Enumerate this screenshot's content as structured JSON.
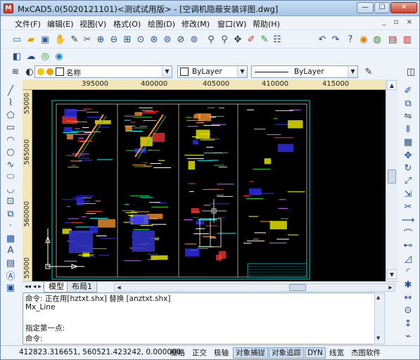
{
  "window": {
    "title": "MxCAD5.0(5020121101)<测试试用版> - [空调机隐蔽安装详图.dwg]",
    "app_icon": "mxcad-app-icon",
    "controls": {
      "minimize": "—",
      "maximize": "☐",
      "close": "✕"
    }
  },
  "menu": {
    "items": [
      "文件(F)",
      "编辑(E)",
      "视图(V)",
      "格式(O)",
      "绘图(D)",
      "修改(M)",
      "窗口(W)",
      "帮助(H)"
    ],
    "doc_controls": "_ ▫ ×"
  },
  "toolbar_icons": {
    "row1": [
      "new-icon",
      "open-icon",
      "save-icon",
      "pan-icon",
      "zoom-in-icon",
      "zoom-out-icon",
      "zoom-window-icon",
      "zoom-all-icon",
      "zoom-prev-icon",
      "zoom-extents-icon",
      "zoom-realtime-icon",
      "zoom-scale-icon",
      "zoom-center-icon",
      "zoom-dynamic-icon",
      "regen-icon",
      "find-icon",
      "zoom-search-icon",
      "move-icon",
      "pencil-icon",
      "brush-icon",
      "eraser-icon",
      "undo-icon",
      "redo-icon",
      "help-icon",
      "globe-icon",
      "print-icon",
      "color-icon",
      "pdf-icon",
      "export-pdf-icon"
    ],
    "row2": [
      "3d-view-icon",
      "cloud-icon",
      "chat-icon",
      "chrome-icon"
    ]
  },
  "layer_bar": {
    "layer_name": "名称",
    "color": "ByLayer",
    "linetype": "ByLayer",
    "layer_colors": {
      "bulb": "#f0c800",
      "sun": "#f0a000",
      "swatch": "#ffffff"
    }
  },
  "rulers": {
    "top": [
      "395000",
      "400000",
      "405000",
      "410000",
      "415000"
    ],
    "left": [
      "55000",
      "565000",
      "560000",
      "55000"
    ]
  },
  "drawing": {
    "background": "#000000",
    "frame_color": "#00cccc",
    "accent_colors": [
      "#ffff00",
      "#ff9933",
      "#ff3333",
      "#3333ff",
      "#33cc33",
      "#00ffff",
      "#ffffff",
      "#cc66ff"
    ]
  },
  "tabs": {
    "nav": "◂◂ ◂ ▸ ▸▸",
    "items": [
      "模型",
      "布局1"
    ]
  },
  "command": {
    "lines": [
      "命令: 正在用[hztxt.shx] 替换 [anztxt.shx]",
      "Mx_Line",
      "",
      "指定第一点:",
      "命令:"
    ]
  },
  "status": {
    "coords": "412823.316651,  560521.423242,  0.000000",
    "buttons": [
      {
        "label": "栅格",
        "on": false
      },
      {
        "label": "正交",
        "on": false
      },
      {
        "label": "极轴",
        "on": false
      },
      {
        "label": "对象捕捉",
        "on": true
      },
      {
        "label": "对象追踪",
        "on": true
      },
      {
        "label": "DYN",
        "on": true
      },
      {
        "label": "线宽",
        "on": false
      },
      {
        "label": "杰图软件",
        "on": false
      }
    ]
  },
  "left_tools": [
    "line-tool-icon",
    "polyline-tool-icon",
    "polygon-tool-icon",
    "rectangle-tool-icon",
    "arc-tool-icon",
    "circle-tool-icon",
    "spline-tool-icon",
    "ellipse-tool-icon",
    "ellipse-arc-tool-icon",
    "insert-block-icon",
    "make-block-icon",
    "point-tool-icon",
    "hatch-tool-icon",
    "text-tool-icon",
    "table-tool-icon",
    "mtext-tool-icon",
    "region-tool-icon"
  ],
  "right_tools": [
    "erase-icon",
    "copy-icon",
    "mirror-icon",
    "offset-icon",
    "array-icon",
    "move-tool-icon",
    "rotate-icon",
    "scale-icon",
    "stretch-icon",
    "trim-icon",
    "extend-icon",
    "break-icon",
    "join-icon",
    "chamfer-icon",
    "fillet-icon",
    "explode-icon",
    "measure-icon",
    "circle-measure-icon",
    "dimension-icon",
    "tape-icon"
  ]
}
